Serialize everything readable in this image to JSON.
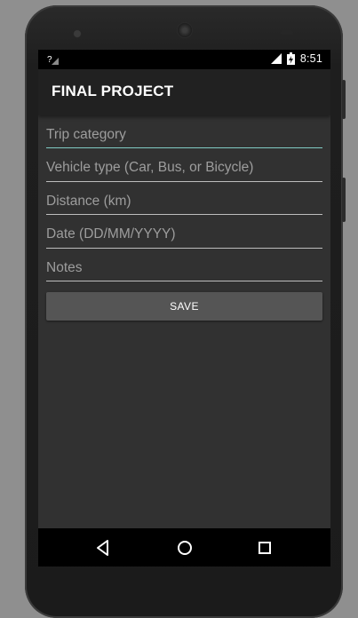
{
  "status_bar": {
    "time": "8:51",
    "sim_icon": "no-sim-icon",
    "signal_icon": "signal-icon",
    "battery_icon": "battery-charging-icon"
  },
  "app_bar": {
    "title": "FINAL PROJECT"
  },
  "form": {
    "fields": [
      {
        "placeholder": "Trip category",
        "value": ""
      },
      {
        "placeholder": "Vehicle type (Car, Bus, or Bicycle)",
        "value": ""
      },
      {
        "placeholder": "Distance (km)",
        "value": ""
      },
      {
        "placeholder": "Date (DD/MM/YYYY)",
        "value": ""
      },
      {
        "placeholder": "Notes",
        "value": ""
      }
    ],
    "save_label": "SAVE"
  },
  "nav_bar": {
    "back_icon": "back-triangle-icon",
    "home_icon": "home-circle-icon",
    "recents_icon": "recents-square-icon"
  },
  "colors": {
    "accent": "#80cbc4",
    "app_bar": "#212121",
    "background": "#313131",
    "button": "#555555"
  }
}
